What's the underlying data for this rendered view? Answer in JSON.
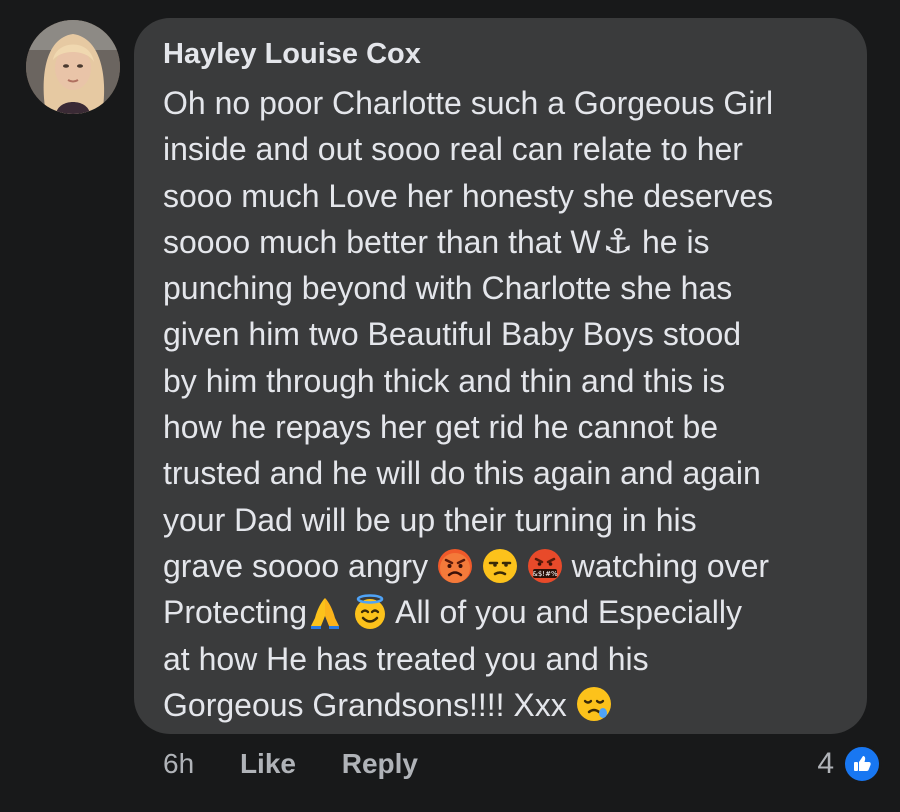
{
  "comment": {
    "author": "Hayley Louise Cox",
    "lines": [
      {
        "text": "Oh no poor Charlotte such a Gorgeous Girl"
      },
      {
        "text": "inside and out sooo real can relate to her"
      },
      {
        "text": "sooo much Love her honesty she deserves"
      },
      {
        "pre": "soooo much better than that W",
        "symbol": "⚓",
        "post": " he is"
      },
      {
        "text": "punching beyond with Charlotte she has"
      },
      {
        "text": "given him two Beautiful Baby Boys stood"
      },
      {
        "text": "by him through thick and thin and this is"
      },
      {
        "text": "how he repays her get rid he cannot be"
      },
      {
        "text": "trusted and he will do this again and again"
      },
      {
        "text": "your Dad will be up their turning in his"
      },
      {
        "pre": "grave soooo angry ",
        "post": " watching over"
      },
      {
        "pre": "Protecting",
        "post": " All of you and Especially"
      },
      {
        "text": "at how He has treated you and his"
      },
      {
        "pre": "Gorgeous Grandsons!!!! Xxx "
      }
    ],
    "emojis": [
      "angry-face",
      "unamused-face",
      "cursing-face",
      "folded-hands",
      "smiling-face-with-halo",
      "sleepy-face"
    ]
  },
  "footer": {
    "time": "6h",
    "like_label": "Like",
    "reply_label": "Reply"
  },
  "reactions": {
    "count": "4",
    "type": "like",
    "color": "#1877f2"
  },
  "colors": {
    "background": "#18191a",
    "bubble": "#3a3b3c",
    "text": "#e4e6eb",
    "secondary_text": "#b0b3b8"
  }
}
